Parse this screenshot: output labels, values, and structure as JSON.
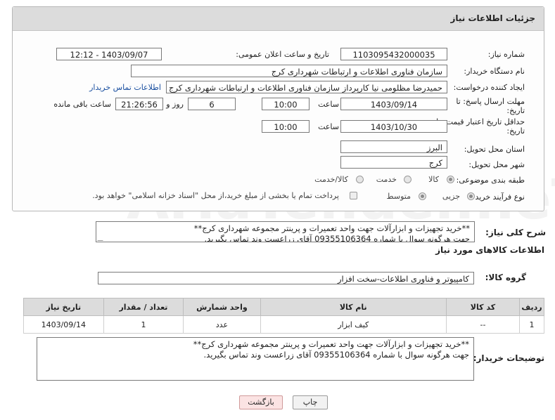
{
  "header": {
    "title": "جزئیات اطلاعات نیاز"
  },
  "form": {
    "need_number": {
      "label": "شماره نیاز:",
      "value": "1103095432000035"
    },
    "announce_datetime": {
      "label": "تاریخ و ساعت اعلان عمومی:",
      "value": "1403/09/07 - 12:12"
    },
    "buyer_org": {
      "label": "نام دستگاه خریدار:",
      "value": "سازمان فناوری اطلاعات و ارتباطات شهرداری کرج"
    },
    "requester": {
      "label": "ایجاد کننده درخواست:",
      "value": "حمیدرضا مظلومی نیا کارپرداز سازمان فناوری اطلاعات و ارتباطات شهرداری کرج",
      "contact_link": "اطلاعات تماس خریدار"
    },
    "reply_deadline": {
      "label_line1": "مهلت ارسال پاسخ: تا",
      "label_line2": "تاریخ:",
      "date": "1403/09/14",
      "time_label": "ساعت",
      "time": "10:00",
      "days": "6",
      "days_label": "روز و",
      "remaining": "21:26:56",
      "remaining_label": "ساعت باقی مانده"
    },
    "price_validity": {
      "label_line1": "حداقل تاریخ اعتبار قیمت: تا",
      "label_line2": "تاریخ:",
      "date": "1403/10/30",
      "time_label": "ساعت",
      "time": "10:00"
    },
    "province": {
      "label": "استان محل تحویل:",
      "value": "البرز"
    },
    "city": {
      "label": "شهر محل تحویل:",
      "value": "کرج"
    },
    "category": {
      "label": "طبقه بندی موضوعی:",
      "options": [
        "کالا",
        "خدمت",
        "کالا/خدمت"
      ],
      "selected": "کالا"
    },
    "purchase_type": {
      "label": "نوع فرآیند خرید :",
      "options": [
        "جزیی",
        "متوسط"
      ],
      "selected": "جزیی",
      "checkbox_label": "پرداخت تمام یا بخشی از مبلغ خرید،از محل \"اسناد خزانه اسلامی\" خواهد بود."
    }
  },
  "description": {
    "label": "شرح کلی نیاز:",
    "line1": "**خرید تجهیزات و ابزارآلات جهت واحد تعمیرات و پرینتر مجموعه شهرداری کرج**",
    "line2": "جهت هرگونه سوال با شماره 09355106364 آقای زراعست وند تماس بگیرید."
  },
  "goods_section": {
    "title": "اطلاعات کالاهای مورد نیاز",
    "group_label": "گروه کالا:",
    "group_value": "کامپیوتر و فناوری اطلاعات-سخت افزار",
    "columns": [
      "ردیف",
      "کد کالا",
      "نام کالا",
      "واحد شمارش",
      "تعداد / مقدار",
      "تاریخ نیاز"
    ],
    "rows": [
      {
        "row": "1",
        "code": "--",
        "name": "کیف ابزار",
        "unit": "عدد",
        "qty": "1",
        "date": "1403/09/14"
      }
    ]
  },
  "buyer_notes": {
    "label": "توضیحات خریدار:",
    "line1": "**خرید تجهیزات و ابزارآلات جهت واحد تعمیرات و پرینتر مجموعه شهرداری کرج**",
    "line2": "جهت هرگونه سوال با شماره 09355106364 آقای زراعست وند تماس بگیرید."
  },
  "buttons": {
    "print": "چاپ",
    "back": "بازگشت"
  },
  "watermark": {
    "text": "AriaTender.neT"
  },
  "colors": {
    "header_bg": "#dcdcdc",
    "link": "#1a4fa0",
    "back_button_bg": "#fbe3e3"
  }
}
